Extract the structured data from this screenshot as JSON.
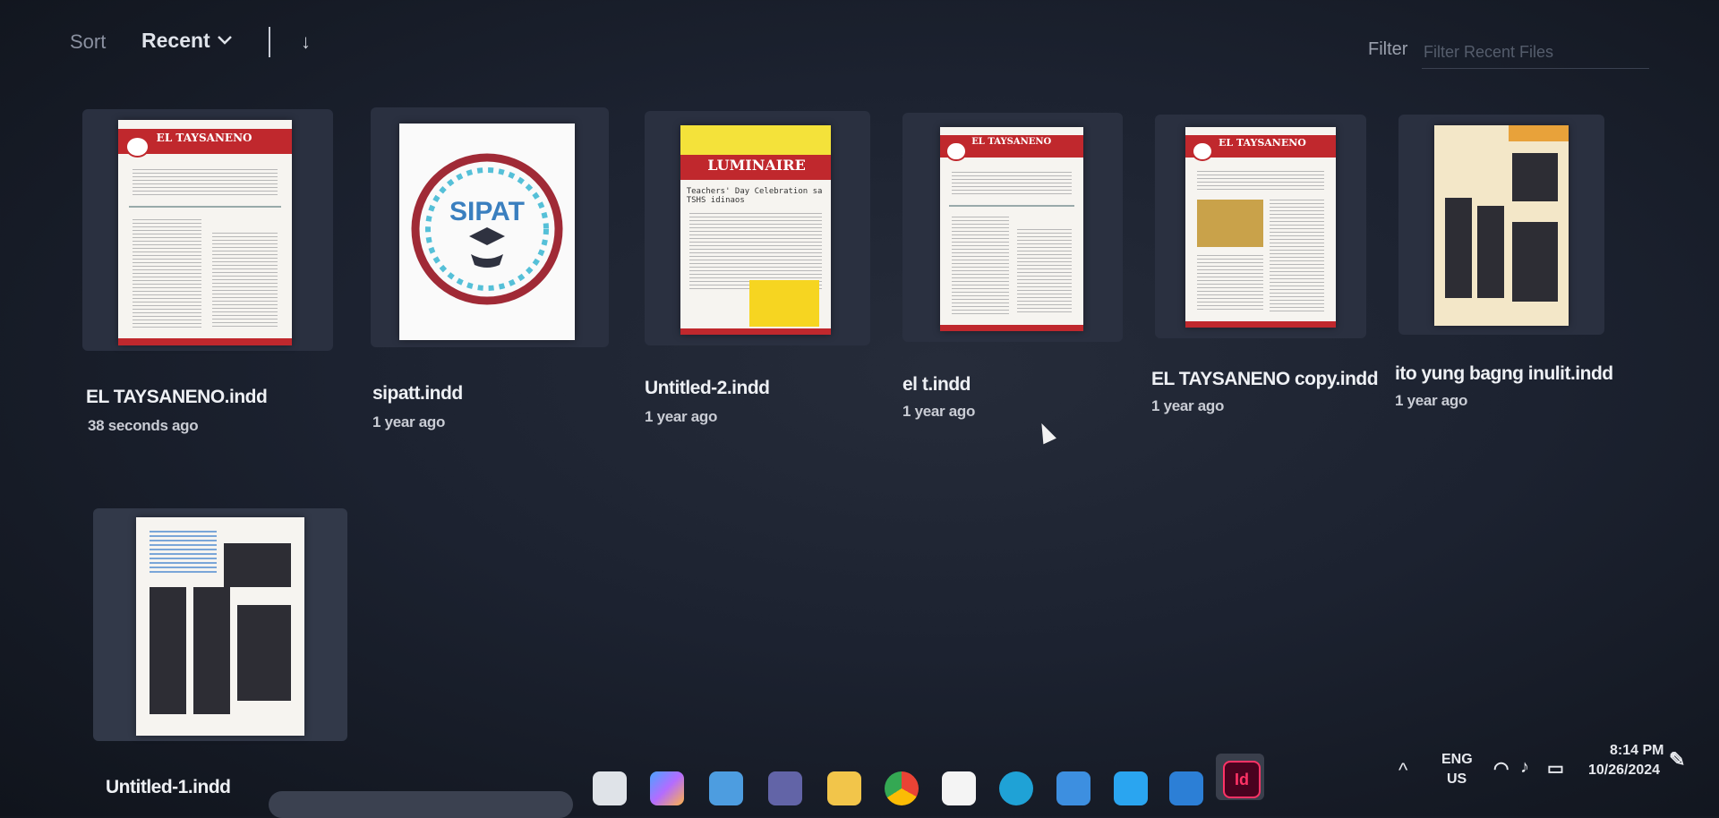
{
  "toolbar": {
    "sort_label": "Sort",
    "sort_value": "Recent",
    "filter_label": "Filter",
    "filter_placeholder": "Filter Recent Files"
  },
  "files": [
    {
      "name": "EL TAYSANENO.indd",
      "time": "38 seconds ago"
    },
    {
      "name": "sipatt.indd",
      "time": "1 year ago"
    },
    {
      "name": "Untitled-2.indd",
      "time": "1 year ago"
    },
    {
      "name": "el t.indd",
      "time": "1 year ago"
    },
    {
      "name": "EL TAYSANENO copy.indd",
      "time": "1 year ago"
    },
    {
      "name": "ito yung bagng inulit.indd",
      "time": "1 year ago"
    },
    {
      "name": "Untitled-1.indd",
      "time": ""
    }
  ],
  "thumb_text": {
    "newspaper": "EL TAYSANENO",
    "luminaire": "LUMINAIRE",
    "luminaire_sub": "Teachers' Day Celebration sa TSHS idinaos",
    "sipat": "SIPAT"
  },
  "taskbar": {
    "lang_top": "ENG",
    "lang_bottom": "US",
    "time": "8:14 PM",
    "date": "10/26/2024",
    "indesign_label": "Id",
    "icons": [
      "file-explorer-icon",
      "copilot-icon",
      "notepad-icon",
      "teams-icon",
      "folder-icon",
      "chrome-icon",
      "store-icon",
      "edge-icon",
      "app-icon",
      "vscode-icon",
      "outlook-icon",
      "indesign-icon"
    ]
  },
  "colors": {
    "accent": "#c0282d",
    "indesign": "#ff3366"
  }
}
